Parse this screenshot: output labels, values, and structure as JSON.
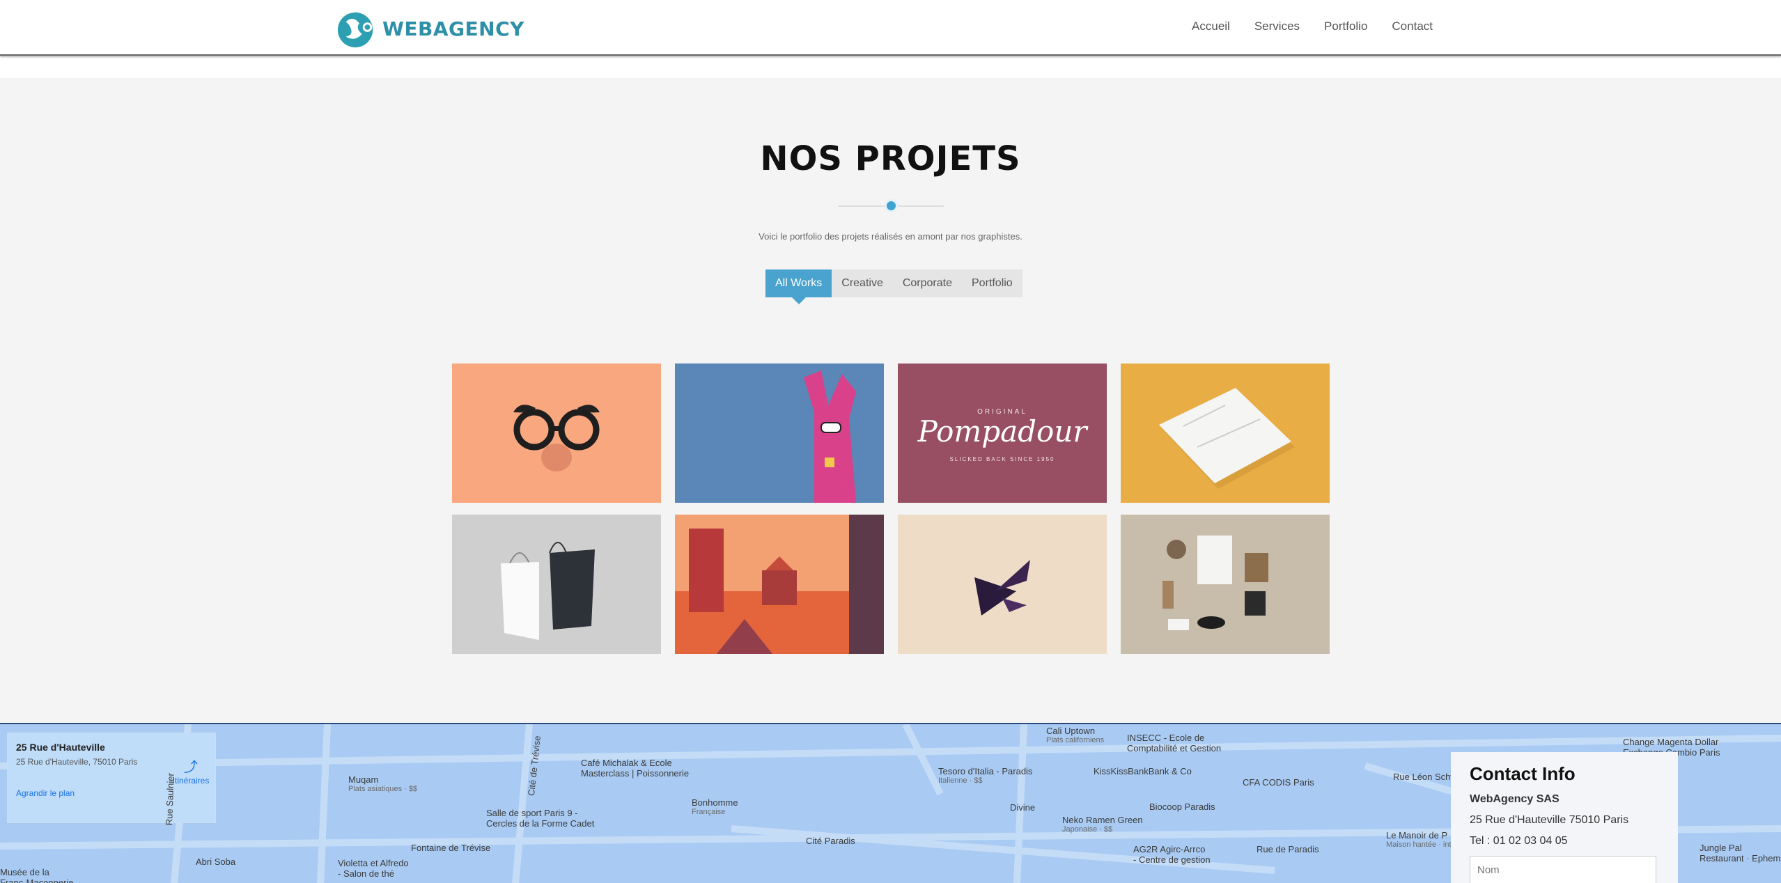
{
  "header": {
    "brand": "WEBAGENCY",
    "nav": [
      "Accueil",
      "Services",
      "Portfolio",
      "Contact"
    ]
  },
  "section": {
    "title": "NOS PROJETS",
    "subtitle": "Voici le portfolio des projets réalisés en amont par nos graphistes.",
    "filters": [
      "All Works",
      "Creative",
      "Corporate",
      "Portfolio"
    ],
    "active_filter": "All Works"
  },
  "portfolio": [
    {
      "name": "glasses",
      "bg": "#f9a77e"
    },
    {
      "name": "pink-rabbit",
      "bg": "#5a87b8"
    },
    {
      "name": "pompadour",
      "bg": "#984e63",
      "text_top": "ORIGINAL",
      "text_main": "Pompadour",
      "text_bottom": "SLICKED BACK SINCE 1950"
    },
    {
      "name": "stationery-paper",
      "bg": "#e9ad45"
    },
    {
      "name": "shopping-bags",
      "bg": "#cfcfcf"
    },
    {
      "name": "city-illustration",
      "bg": "#f08a57"
    },
    {
      "name": "origami-bird",
      "bg": "#efdcc7"
    },
    {
      "name": "branding-mockup",
      "bg": "#c8bcab"
    }
  ],
  "map": {
    "place_title": "25 Rue d'Hauteville",
    "place_address": "25 Rue d'Hauteville, 75010 Paris",
    "directions": "Itinéraires",
    "enlarge": "Agrandir le plan",
    "labels": [
      {
        "t": "Café Michalak & Ecole",
        "s": "Masterclass | Poissonnerie"
      },
      {
        "t": "Muqam",
        "s": "Plats asiatiques · $$"
      },
      {
        "t": "Bonhomme",
        "s": "Française"
      },
      {
        "t": "Tesoro d'Italia - Paradis",
        "s": "Italienne · $$"
      },
      {
        "t": "Cali Uptown",
        "s": "Plats californiens"
      },
      {
        "t": "INSECC - Ecole de",
        "s": "Comptabilité et Gestion"
      },
      {
        "t": "KissKissBankBank & Co",
        "s": ""
      },
      {
        "t": "CFA CODIS Paris",
        "s": ""
      },
      {
        "t": "Salle de sport Paris 9 -",
        "s": "Cercles de la Forme Cadet"
      },
      {
        "t": "Divine",
        "s": ""
      },
      {
        "t": "Biocoop Paradis",
        "s": ""
      },
      {
        "t": "Neko Ramen Green",
        "s": "Japonaise · $$"
      },
      {
        "t": "Fontaine de Trévise",
        "s": ""
      },
      {
        "t": "Abri Soba",
        "s": ""
      },
      {
        "t": "Violetta et Alfredo",
        "s": "- Salon de thé"
      },
      {
        "t": "Cité Paradis",
        "s": ""
      },
      {
        "t": "AG2R Agirc-Arrco",
        "s": "- Centre de gestion"
      },
      {
        "t": "Rue de Paradis",
        "s": ""
      },
      {
        "t": "Rue Léon Schwartz",
        "s": ""
      },
      {
        "t": "Le Manoir de P",
        "s": "Maison hantée · int..."
      },
      {
        "t": "Change Magenta Dollar",
        "s": "Exchange Cambio Paris"
      },
      {
        "t": "Jungle Pal",
        "s": "Restaurant · Ephem"
      },
      {
        "t": "Musée de la",
        "s": "Franc-Maçonnerie"
      },
      {
        "t": "Rue Saulnier",
        "s": ""
      },
      {
        "t": "Cité de Trévise",
        "s": ""
      }
    ]
  },
  "contact": {
    "title": "Contact Info",
    "company": "WebAgency SAS",
    "address": "25 Rue d'Hauteville 75010 Paris",
    "phone": "Tel : 01 02 03 04 05",
    "name_placeholder": "Nom"
  }
}
